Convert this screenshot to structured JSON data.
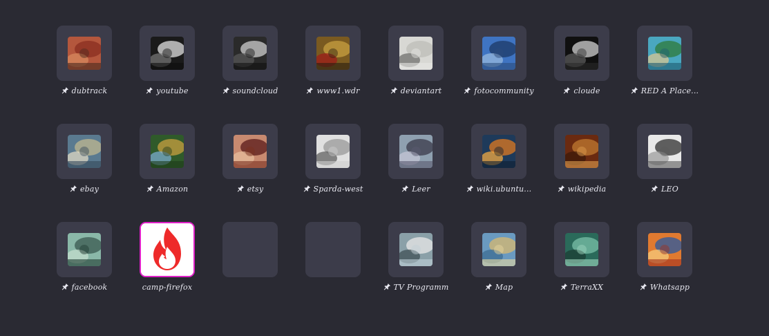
{
  "tiles": [
    {
      "label": "dubtrack",
      "pinned": true,
      "colors": [
        "#b4573d",
        "#8a2e20",
        "#d98b60",
        "#4a2a1e"
      ]
    },
    {
      "label": "youtube",
      "pinned": true,
      "colors": [
        "#1a1a1a",
        "#e0e0e0",
        "#7a7a7a",
        "#0d0d0d"
      ]
    },
    {
      "label": "soundcloud",
      "pinned": true,
      "colors": [
        "#2a2a2a",
        "#cfcfcf",
        "#5a5a5a",
        "#111111"
      ]
    },
    {
      "label": "www1.wdr",
      "pinned": true,
      "colors": [
        "#7a5a20",
        "#c8a040",
        "#a01818",
        "#2a1e10"
      ]
    },
    {
      "label": "deviantart",
      "pinned": true,
      "colors": [
        "#d8d8d4",
        "#bdbdb8",
        "#6a6a66",
        "#e8e8e4"
      ]
    },
    {
      "label": "fotocommunity",
      "pinned": true,
      "colors": [
        "#3f74c2",
        "#1e3a66",
        "#9dbde0",
        "#2c4c7c"
      ]
    },
    {
      "label": "cloude",
      "pinned": true,
      "colors": [
        "#101010",
        "#d0d0d0",
        "#606060",
        "#2a2a2a"
      ]
    },
    {
      "label": "RED A Place...",
      "pinned": true,
      "colors": [
        "#4aa7c0",
        "#2f7a3a",
        "#e0c890",
        "#1e5a70"
      ]
    },
    {
      "label": "ebay",
      "pinned": true,
      "colors": [
        "#5a7a90",
        "#c0b890",
        "#e8e0c8",
        "#33485a"
      ]
    },
    {
      "label": "Amazon",
      "pinned": true,
      "colors": [
        "#2f5a2a",
        "#c9a040",
        "#7fb0d8",
        "#1e3a1a"
      ]
    },
    {
      "label": "etsy",
      "pinned": true,
      "colors": [
        "#c88a70",
        "#5a1a1a",
        "#e8c0a0",
        "#7a3020"
      ]
    },
    {
      "label": "Sparda-west",
      "pinned": true,
      "colors": [
        "#e0e0e0",
        "#9a9a9a",
        "#5a5a5a",
        "#cfcfcf"
      ]
    },
    {
      "label": "Leer",
      "pinned": true,
      "colors": [
        "#8fa0b0",
        "#3a3a4a",
        "#c8c8d8",
        "#5a5a70"
      ]
    },
    {
      "label": "wiki.ubuntu...",
      "pinned": true,
      "colors": [
        "#1e3a5a",
        "#e07a20",
        "#ffb040",
        "#0e1e30"
      ]
    },
    {
      "label": "wikipedia",
      "pinned": true,
      "colors": [
        "#6a2a10",
        "#c07a30",
        "#3a1808",
        "#e0a050"
      ]
    },
    {
      "label": "LEO",
      "pinned": true,
      "colors": [
        "#e8e8e8",
        "#303030",
        "#9a9a9a",
        "#5a5a5a"
      ]
    },
    {
      "label": "facebook",
      "pinned": true,
      "colors": [
        "#8ab8a8",
        "#3a5a50",
        "#c8e0d0",
        "#1e3a30"
      ]
    },
    {
      "label": "camp-firefox",
      "pinned": false,
      "active": true,
      "colors": [
        "#ee2a2a",
        "#ffffff"
      ]
    },
    {
      "label": "",
      "pinned": false,
      "empty": true
    },
    {
      "label": "",
      "pinned": false,
      "empty": true
    },
    {
      "label": "TV Programm",
      "pinned": true,
      "colors": [
        "#8aa0a8",
        "#e8e8e8",
        "#3a4a50",
        "#c0d0d8"
      ]
    },
    {
      "label": "Map",
      "pinned": true,
      "colors": [
        "#6a9ac0",
        "#d8b870",
        "#3a6a90",
        "#e8d8a0"
      ]
    },
    {
      "label": "TerraXX",
      "pinned": true,
      "colors": [
        "#2a6a5a",
        "#7ac0a8",
        "#1a3a30",
        "#a0d8c0"
      ]
    },
    {
      "label": "Whatsapp",
      "pinned": true,
      "colors": [
        "#e07a30",
        "#2a5aa0",
        "#f8d080",
        "#a03020"
      ]
    }
  ]
}
